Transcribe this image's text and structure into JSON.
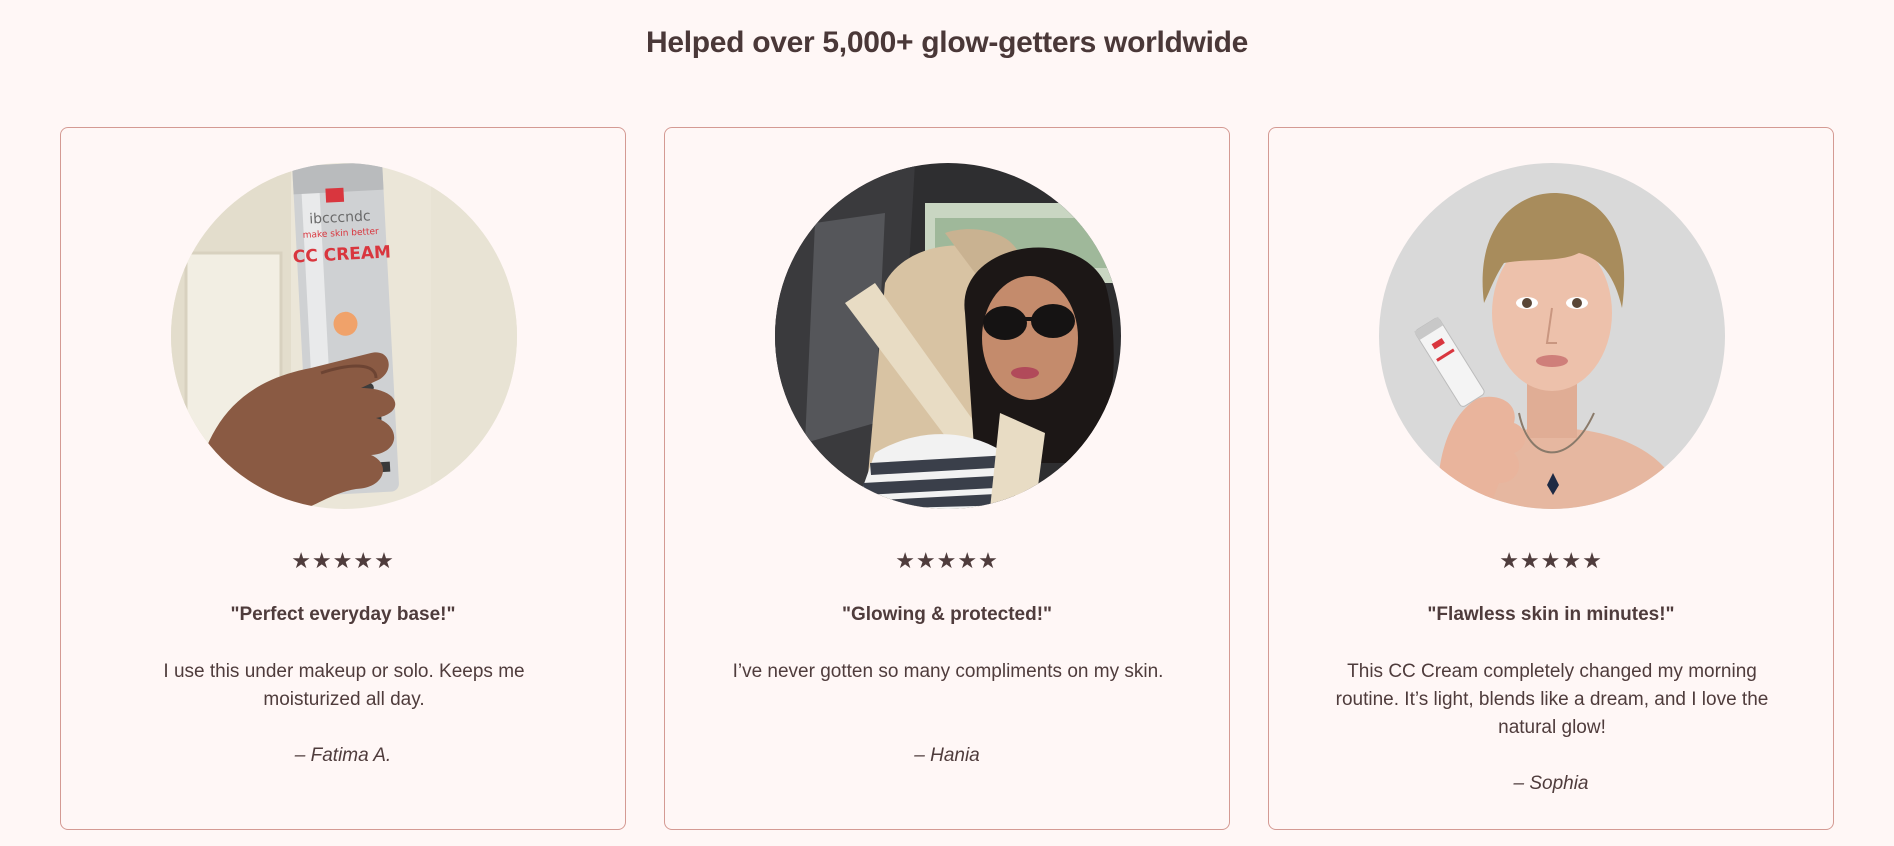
{
  "section": {
    "heading": "Helped over 5,000+ glow-getters worldwide"
  },
  "reviews": [
    {
      "rating": 5,
      "stars": "★★★★★",
      "title": "\"Perfect everyday base!\"",
      "body": "I use this under makeup or solo. Keeps me moisturized all day.",
      "author": "– Fatima A.",
      "photo_icon": "product-in-hand-photo"
    },
    {
      "rating": 5,
      "stars": "★★★★★",
      "title": "\"Glowing & protected!\"",
      "body": "I’ve never gotten so many compliments on my skin.",
      "author": "– Hania",
      "photo_icon": "car-selfie-photo"
    },
    {
      "rating": 5,
      "stars": "★★★★★",
      "title": "\"Flawless skin in minutes!\"",
      "body": "This CC Cream completely changed my morning routine. It’s light, blends like a dream, and I love the natural glow!",
      "author": "– Sophia",
      "photo_icon": "model-holding-product-photo"
    }
  ],
  "product_label": {
    "brand": "ibcccndc",
    "tagline": "make skin better",
    "name": "CC CREAM"
  },
  "colors": {
    "background": "#fff7f6",
    "card_border": "#d49a93",
    "text": "#4f3c3c"
  }
}
